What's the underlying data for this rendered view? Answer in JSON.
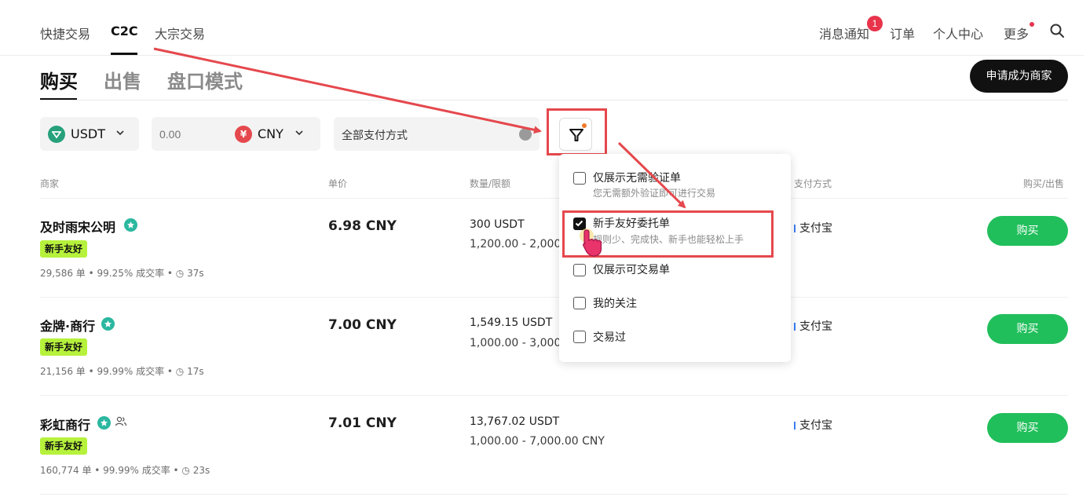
{
  "nav": {
    "left": [
      {
        "label": "快捷交易"
      },
      {
        "label": "C2C"
      },
      {
        "label": "大宗交易"
      }
    ],
    "right": {
      "notifications": "消息通知",
      "notifications_count": "1",
      "orders": "订单",
      "profile": "个人中心",
      "more": "更多"
    }
  },
  "tabs": {
    "buy": "购买",
    "sell": "出售",
    "orderbook": "盘口模式"
  },
  "merchant_button": "申请成为商家",
  "filters": {
    "coin": "USDT",
    "amount_placeholder": "0.00",
    "fiat": "CNY",
    "payment": "全部支付方式"
  },
  "table_headers": {
    "merchant": "商家",
    "price": "单价",
    "quantity": "数量/限额",
    "payment": "支付方式",
    "action": "购买/出售"
  },
  "rows": [
    {
      "name": "及时雨宋公明",
      "tag": "新手友好",
      "stats": "29,586 单 • 99.25% 成交率 • ◷ 37s",
      "price": "6.98 CNY",
      "qty": "300 USDT",
      "limit": "1,200.00 - 2,000.",
      "payment": "支付宝",
      "button": "购买"
    },
    {
      "name": "金牌·商行",
      "tag": "新手友好",
      "stats": "21,156 单 • 99.99% 成交率 • ◷ 17s",
      "price": "7.00 CNY",
      "qty": "1,549.15 USDT",
      "limit": "1,000.00 - 3,000.",
      "payment": "支付宝",
      "button": "购买"
    },
    {
      "name": "彩虹商行",
      "tag": "新手友好",
      "stats": "160,774 单 • 99.99% 成交率 • ◷ 23s",
      "price": "7.01 CNY",
      "qty": "13,767.02 USDT",
      "limit": "1,000.00 - 7,000.00 CNY",
      "payment": "支付宝",
      "button": "购买"
    }
  ],
  "dropdown": {
    "options": [
      {
        "label": "仅展示无需验证单",
        "desc": "您无需额外验证即可进行交易",
        "checked": false
      },
      {
        "label": "新手友好委托单",
        "desc": "规则少、完成快、新手也能轻松上手",
        "checked": true
      },
      {
        "label": "仅展示可交易单",
        "checked": false
      },
      {
        "label": "我的关注",
        "checked": false
      },
      {
        "label": "交易过",
        "checked": false
      }
    ]
  },
  "colors": {
    "accent_green": "#21bf5b",
    "tag_lime": "#b6f23c",
    "annotation_red": "#e5484d",
    "badge_red": "#e8334b"
  }
}
